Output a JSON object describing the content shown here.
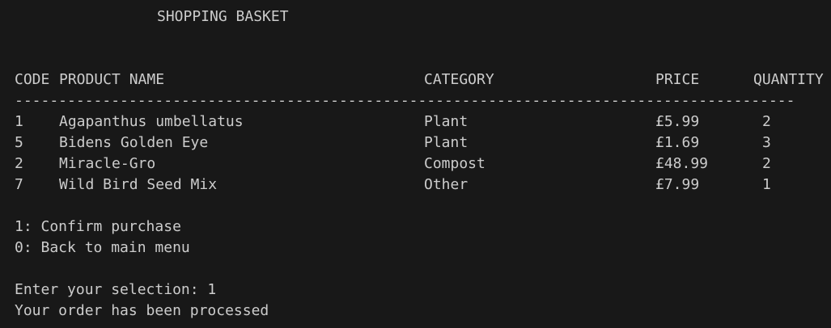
{
  "title": "SHOPPING BASKET",
  "columns": {
    "code": "CODE",
    "product_name": "PRODUCT NAME",
    "category": "CATEGORY",
    "price": "PRICE",
    "quantity": "QUANTITY"
  },
  "divider": "-----------------------------------------------------------------------------------------",
  "rows": [
    {
      "code": "1",
      "name": "Agapanthus umbellatus",
      "category": "Plant",
      "price": "£5.99",
      "quantity": "2"
    },
    {
      "code": "5",
      "name": "Bidens Golden Eye",
      "category": "Plant",
      "price": "£1.69",
      "quantity": "3"
    },
    {
      "code": "2",
      "name": "Miracle-Gro",
      "category": "Compost",
      "price": "£48.99",
      "quantity": "2"
    },
    {
      "code": "7",
      "name": "Wild Bird Seed Mix",
      "category": "Other",
      "price": "£7.99",
      "quantity": "1"
    }
  ],
  "menu": [
    "1: Confirm purchase",
    "0: Back to main menu"
  ],
  "prompt": "Enter your selection: 1",
  "status": "Your order has been processed"
}
